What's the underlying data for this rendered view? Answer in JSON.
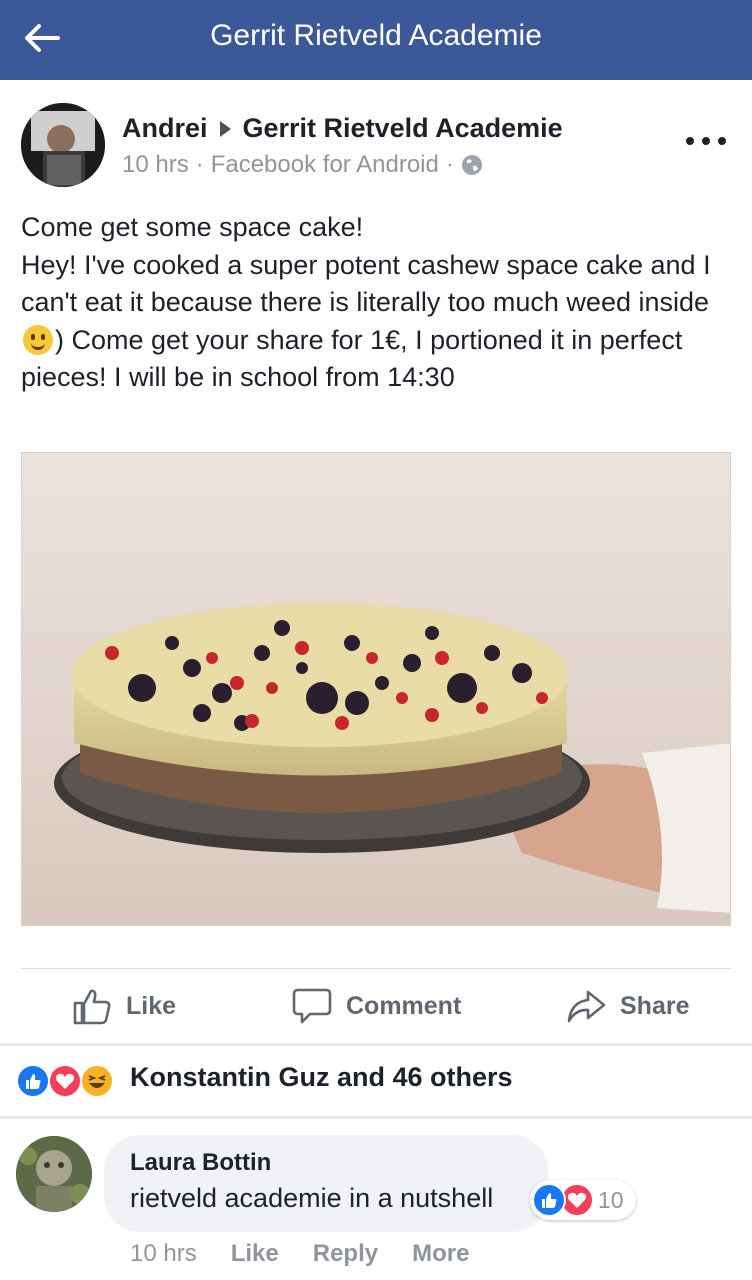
{
  "header": {
    "title": "Gerrit Rietveld Academie",
    "back_icon": "arrow-left-icon",
    "bg_color": "#3b5998"
  },
  "post": {
    "author": "Andrei",
    "target_group": "Gerrit Rietveld Academie",
    "time": "10 hrs",
    "via": "Facebook for Android",
    "privacy_icon": "globe-icon",
    "text_line1": "Come get some space cake!",
    "text_part1": "Hey! I've cooked a super potent cashew space cake and I can't eat it because there is literally too much weed inside",
    "text_part2": ") Come get your share for 1€, I portioned it in perfect pieces! I will be in school from 14:30",
    "photo_icon": "cake-photo"
  },
  "actions": {
    "like": "Like",
    "comment": "Comment",
    "share": "Share"
  },
  "reactions": {
    "summary": "Konstantin Guz and 46 others",
    "icons": [
      "like-reaction-icon",
      "love-reaction-icon",
      "haha-reaction-icon"
    ]
  },
  "comment": {
    "author": "Laura Bottin",
    "text": "rietveld academie in a nutshell",
    "reaction_count": "10",
    "time": "10 hrs",
    "like": "Like",
    "reply": "Reply",
    "more": "More"
  },
  "colors": {
    "like_blue": "#1877f2",
    "love_red": "#f33e58",
    "haha_yellow": "#f7b125"
  }
}
